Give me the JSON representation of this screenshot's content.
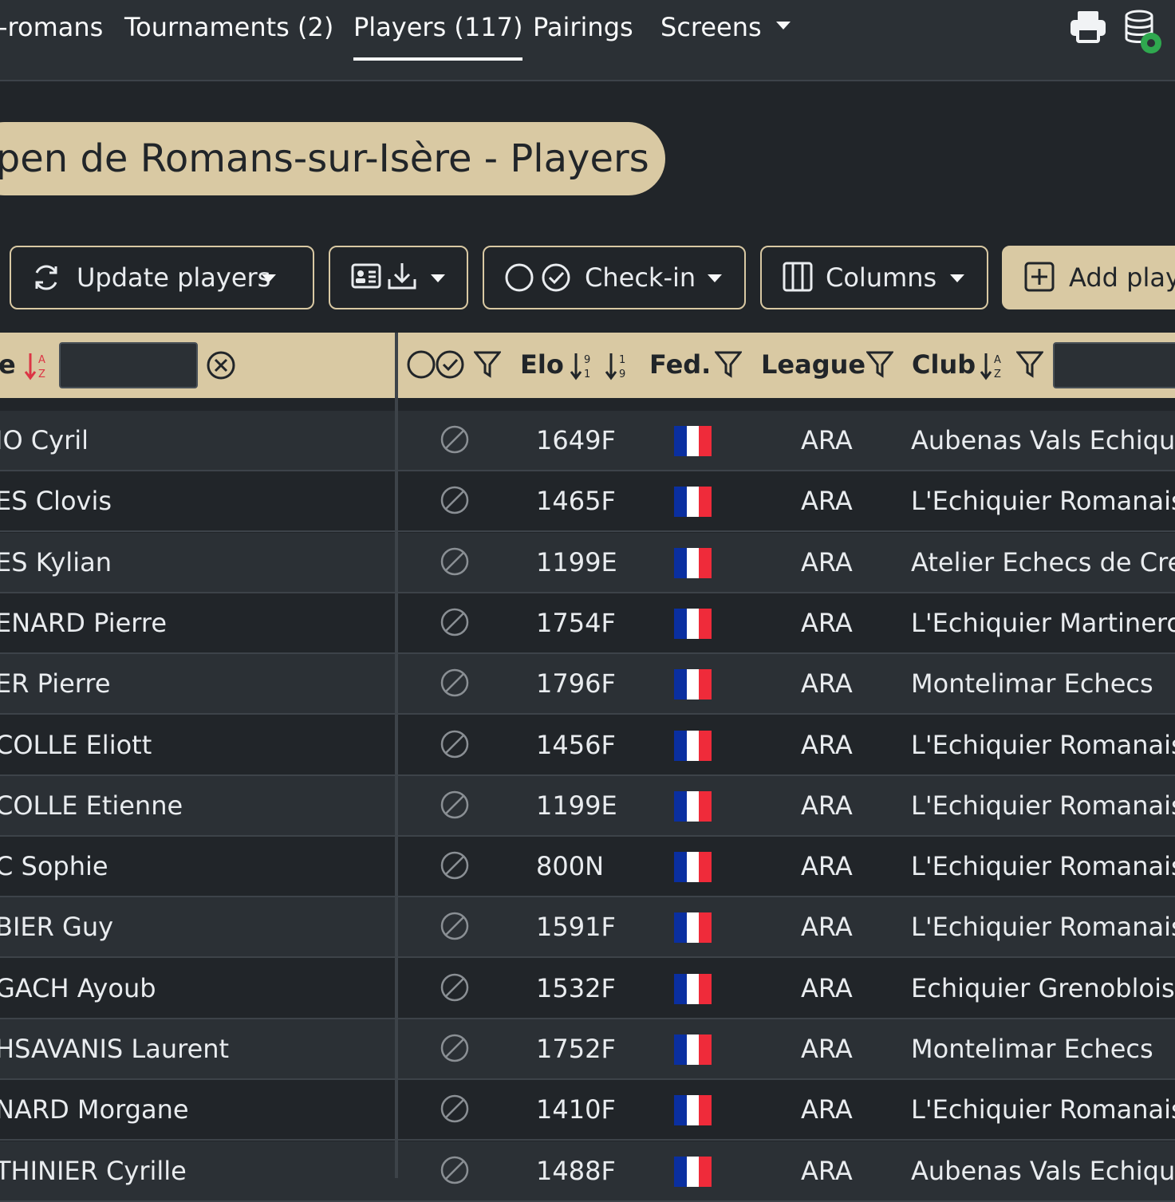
{
  "nav": {
    "items": [
      {
        "label": "-romans"
      },
      {
        "label": "Tournaments (2)"
      },
      {
        "label": "Players (117)"
      },
      {
        "label": "Pairings"
      },
      {
        "label": "Screens"
      }
    ],
    "icons": [
      "printer-icon",
      "database-settings-icon"
    ]
  },
  "page": {
    "title": "Open de Romans-sur-Isère - Players"
  },
  "toolbar": {
    "update_label": "Update players",
    "checkin_label": "Check-in",
    "columns_label": "Columns",
    "add_label": "Add play"
  },
  "table": {
    "headers": {
      "name": "e",
      "elo": "Elo",
      "fed": "Fed.",
      "league": "League",
      "club": "Club"
    },
    "rows": [
      {
        "name": "IO Cyril",
        "elo": "1649F",
        "league": "ARA",
        "club": "Aubenas Vals Echiqui"
      },
      {
        "name": "ES Clovis",
        "elo": "1465F",
        "league": "ARA",
        "club": "L'Echiquier Romanais"
      },
      {
        "name": "ES Kylian",
        "elo": "1199E",
        "league": "ARA",
        "club": "Atelier Echecs de Cre"
      },
      {
        "name": "ENARD Pierre",
        "elo": "1754F",
        "league": "ARA",
        "club": "L'Echiquier Martineroi"
      },
      {
        "name": "ER Pierre",
        "elo": "1796F",
        "league": "ARA",
        "club": "Montelimar Echecs"
      },
      {
        "name": "COLLE Eliott",
        "elo": "1456F",
        "league": "ARA",
        "club": "L'Echiquier Romanais"
      },
      {
        "name": "COLLE Etienne",
        "elo": "1199E",
        "league": "ARA",
        "club": "L'Echiquier Romanais"
      },
      {
        "name": "C Sophie",
        "elo": "800N",
        "league": "ARA",
        "club": "L'Echiquier Romanais"
      },
      {
        "name": "BIER Guy",
        "elo": "1591F",
        "league": "ARA",
        "club": "L'Echiquier Romanais"
      },
      {
        "name": "GACH Ayoub",
        "elo": "1532F",
        "league": "ARA",
        "club": "Echiquier Grenoblois"
      },
      {
        "name": "HSAVANIS Laurent",
        "elo": "1752F",
        "league": "ARA",
        "club": "Montelimar Echecs"
      },
      {
        "name": "NARD Morgane",
        "elo": "1410F",
        "league": "ARA",
        "club": "L'Echiquier Romanais"
      },
      {
        "name": "THINIER Cyrille",
        "elo": "1488F",
        "league": "ARA",
        "club": "Aubenas Vals Echiqui"
      }
    ]
  },
  "colors": {
    "accent": "#d9c9a3",
    "background": "#212529",
    "navbar": "#2b3035",
    "flag_blue": "#0a2fa0",
    "flag_white": "#ffffff",
    "flag_red": "#ef2b3a"
  }
}
